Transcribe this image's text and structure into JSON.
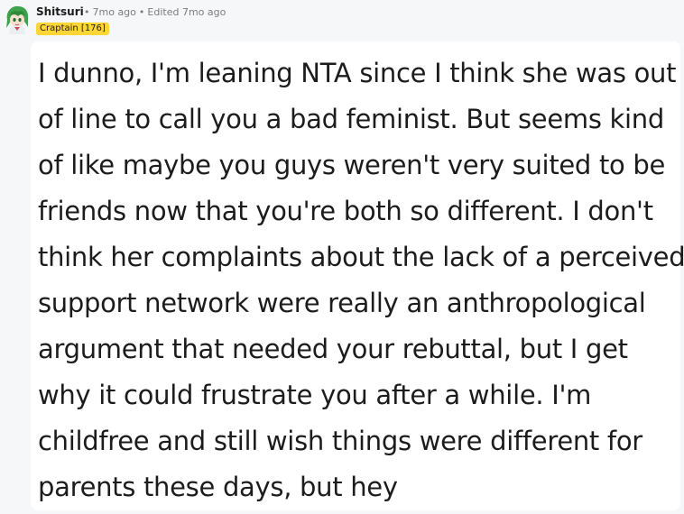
{
  "comment": {
    "author": "Shitsuri",
    "time": "7mo ago",
    "edited": "Edited 7mo ago",
    "flair": "Craptain [176]",
    "lines": [
      "I dunno, I'm leaning NTA since I think she was out",
      "of line to call you a bad feminist. But seems kind",
      "of like maybe you guys weren't very suited to be",
      "friends now that you're both so different. I don't",
      "think her complaints about the lack of a perceived",
      "support network were really an anthropological",
      "argument that needed your rebuttal, but I get",
      "why it could frustrate you after a while. I'm",
      "childfree and still wish things were different for",
      "parents these days, but hey"
    ]
  },
  "colors": {
    "flair_bg": "#ffd635",
    "card_bg": "#ffffff",
    "page_bg": "#f6f7f8",
    "avatar_hair": "#3fa34d"
  },
  "icons": {
    "avatar": "avatar-icon"
  }
}
